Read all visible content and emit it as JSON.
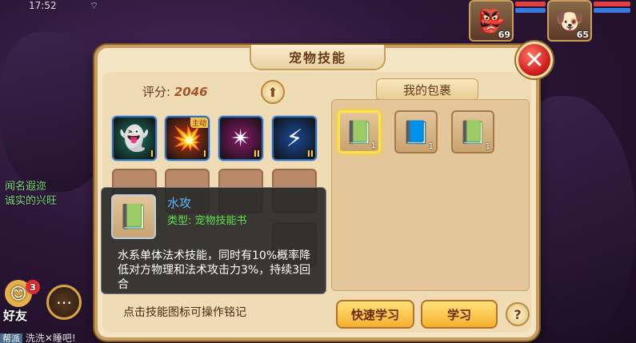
{
  "status": {
    "time": "17:52",
    "wifi": "⌔"
  },
  "portraits": [
    {
      "name": "monkey-portrait",
      "icon": "👺",
      "level": "69"
    },
    {
      "name": "dog-portrait",
      "icon": "🐶",
      "level": "65"
    }
  ],
  "left_overlay": {
    "line1": "闻名遐迩",
    "line2": "诚实的兴旺",
    "friend_label": "好友",
    "friend_badge": "3",
    "chat_tag": "帮派",
    "chat_text": "洗洗✕睡吧!"
  },
  "panel": {
    "title": "宠物技能",
    "close_glyph": "✕",
    "score_label": "评分:",
    "score_value": "2046",
    "up_glyph": "⬆",
    "bag_title": "我的包裹",
    "hint": "点击技能图标可操作铭记",
    "quick_learn": "快速学习",
    "learn": "学习",
    "help": "?"
  },
  "skills": [
    {
      "icon": "👻",
      "tier": "I",
      "color": "#1c7a6a",
      "active": ""
    },
    {
      "icon": "💥",
      "tier": "I",
      "color": "#b83a12",
      "active": "主动"
    },
    {
      "icon": "✴",
      "tier": "II",
      "color": "#8a1a6a",
      "active": ""
    },
    {
      "icon": "⚡",
      "tier": "II",
      "color": "#1a4a9a",
      "active": ""
    }
  ],
  "bag_items": [
    {
      "icon": "📗",
      "count": "1",
      "selected": true
    },
    {
      "icon": "📘",
      "count": "1",
      "selected": false
    },
    {
      "icon": "📗",
      "count": "1",
      "selected": false
    }
  ],
  "tooltip": {
    "icon": "📗",
    "name": "水攻",
    "type": "类型: 宠物技能书",
    "description": "水系单体法术技能，同时有10%概率降低对方物理和法术攻击力3%，持续3回合"
  }
}
